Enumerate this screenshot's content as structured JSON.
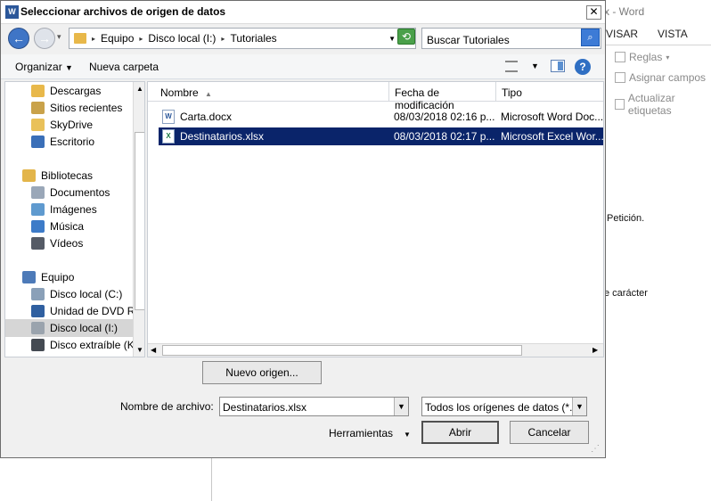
{
  "background": {
    "title": "x - Word",
    "tabs": [
      "VISAR",
      "VISTA"
    ],
    "ribbon": [
      "Reglas",
      "Asignar campos",
      "Actualizar etiquetas"
    ],
    "doc_text": [
      "Petición.",
      "e carácter"
    ]
  },
  "dialog": {
    "title": "Seleccionar archivos de origen de datos",
    "close": "✕",
    "breadcrumb": [
      "Equipo",
      "Disco local (I:)",
      "Tutoriales"
    ],
    "search_placeholder": "Buscar Tutoriales",
    "toolbar": {
      "organize": "Organizar",
      "new_folder": "Nueva carpeta",
      "help": "?"
    },
    "nav_items": [
      {
        "label": "Descargas",
        "icon": "folder-download-icon",
        "color": "#e8b84a"
      },
      {
        "label": "Sitios recientes",
        "icon": "recent-places-icon",
        "color": "#c9a24a"
      },
      {
        "label": "SkyDrive",
        "icon": "skydrive-icon",
        "color": "#e9c15a"
      },
      {
        "label": "Escritorio",
        "icon": "desktop-icon",
        "color": "#3a6fb8"
      },
      {
        "label": "Bibliotecas",
        "icon": "libraries-icon",
        "color": "#e3b54a"
      },
      {
        "label": "Documentos",
        "icon": "documents-icon",
        "color": "#9aa7b8"
      },
      {
        "label": "Imágenes",
        "icon": "pictures-icon",
        "color": "#5f9acf"
      },
      {
        "label": "Música",
        "icon": "music-icon",
        "color": "#3d7bc8"
      },
      {
        "label": "Vídeos",
        "icon": "videos-icon",
        "color": "#555b66"
      },
      {
        "label": "Equipo",
        "icon": "computer-icon",
        "color": "#4d7ab8"
      },
      {
        "label": "Disco local (C:)",
        "icon": "drive-c-icon",
        "color": "#8aa0b8"
      },
      {
        "label": "Unidad de DVD RW",
        "icon": "dvd-drive-icon",
        "color": "#2f5fa0"
      },
      {
        "label": "Disco local (I:)",
        "icon": "drive-i-icon",
        "color": "#9aa3ad"
      },
      {
        "label": "Disco extraíble (K:)",
        "icon": "removable-drive-icon",
        "color": "#444a52"
      }
    ],
    "columns": [
      "Nombre",
      "Fecha de modificación",
      "Tipo"
    ],
    "files": [
      {
        "name": "Carta.docx",
        "date": "08/03/2018 02:16 p...",
        "type": "Microsoft Word Doc...",
        "badge": "W",
        "badge_color": "#2b579a"
      },
      {
        "name": "Destinatarios.xlsx",
        "date": "08/03/2018 02:17 p...",
        "type": "Microsoft Excel Wor...",
        "badge": "X",
        "badge_color": "#1d7a45"
      }
    ],
    "new_source": "Nuevo origen...",
    "filename_label": "Nombre de archivo:",
    "filename_value": "Destinatarios.xlsx",
    "filter_value": "Todos los orígenes de datos (*.o",
    "tools": "Herramientas",
    "open": "Abrir",
    "cancel": "Cancelar"
  }
}
